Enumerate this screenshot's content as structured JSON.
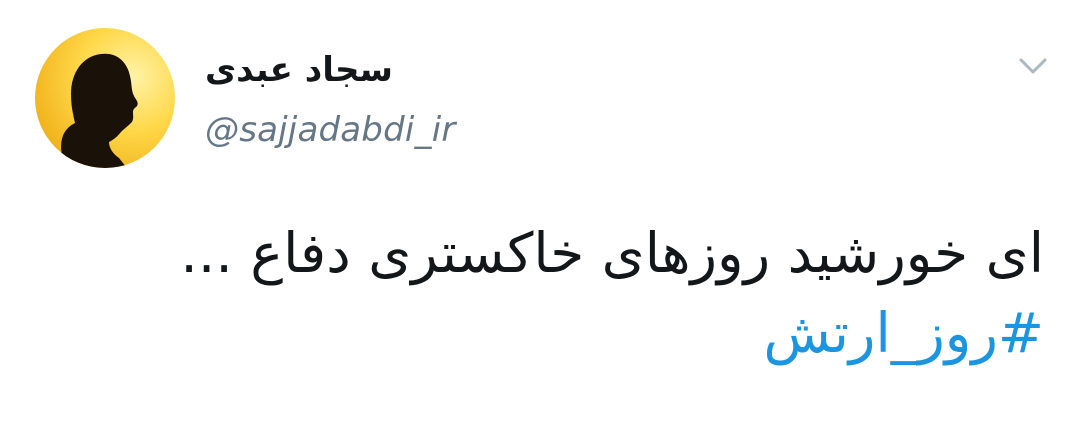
{
  "tweet": {
    "author": {
      "display_name": "سجاد عبدی",
      "handle": "@sajjadabdi_ir",
      "avatar_icon": "profile-silhouette-avatar"
    },
    "menu_icon": "chevron-down-icon",
    "text_line": "ای خورشید روزهای خاکستری دفاع ...",
    "hashtag": "#روز_ارتش"
  },
  "colors": {
    "text": "#14171a",
    "secondary_text": "#657786",
    "link": "#1b95e0",
    "chevron": "#aab8c2",
    "background": "#ffffff"
  }
}
